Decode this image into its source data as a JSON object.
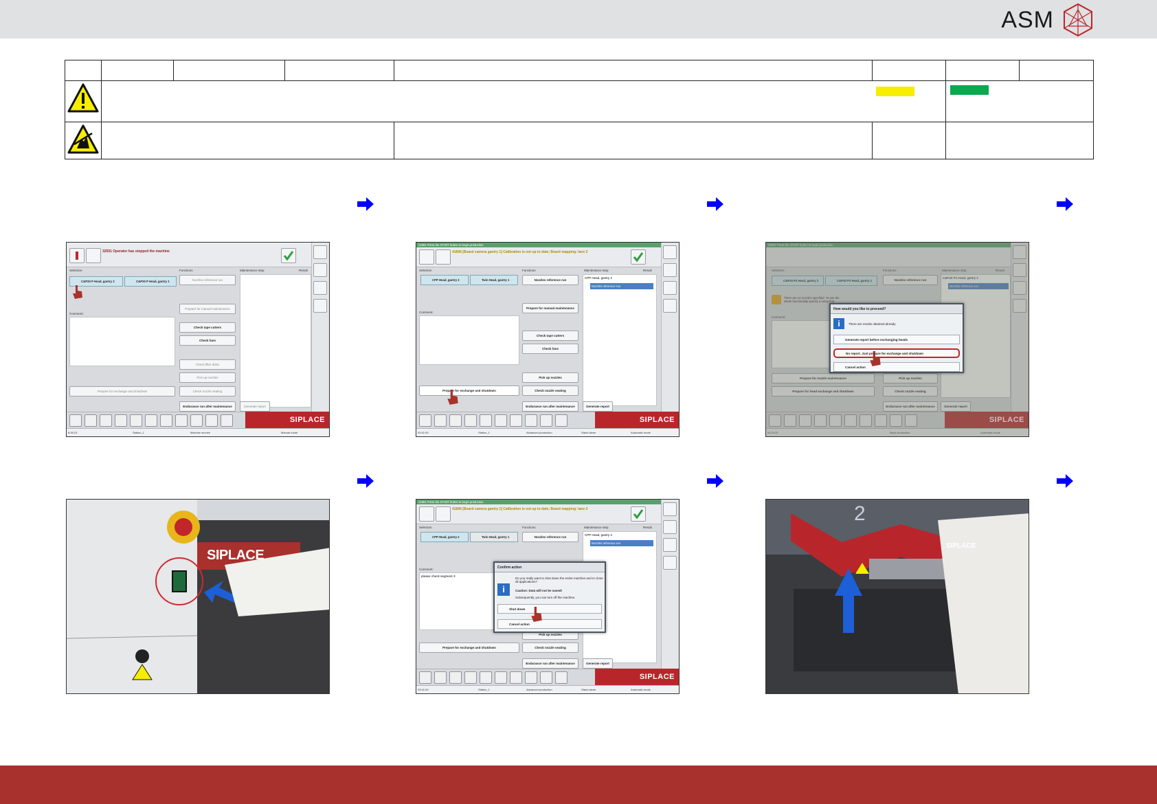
{
  "header": {
    "brand": "ASM"
  },
  "screens": {
    "s1": {
      "message": "32551 Operator has stopped the machine",
      "col_selection": "Selection",
      "col_functions": "Functions",
      "col_maint": "Maintenance step",
      "col_result": "Result",
      "head_a": "C&P20 P Head, gantry 2",
      "head_b": "C&P20 P Head, gantry 1",
      "btn_nozzles": "Nozzles reference run",
      "btn_prepare_manual": "Prepare for manual maintenance",
      "comment": "Comment:",
      "btn_tape": "Check tape cutters",
      "btn_fans": "Check fans",
      "btn_filter": "Check filter disks",
      "btn_pickup": "Pick up nozzles",
      "btn_check_nozzle": "Check nozzle seating",
      "btn_prepare_exchange": "Prepare for exchange and shutdown",
      "btn_endurance": "Endurance run after maintenance",
      "btn_report": "Generate report",
      "brand": "SIPLACE",
      "status_time": "8:35:23",
      "status_line": "Machine service",
      "status_station": "Station_1",
      "status_mode": "Manual mode"
    },
    "s2": {
      "topline": "21981 Press the START button to begin production",
      "message": "41806 [Board camera gantry 1] Calibration is not up to date; Board mapping: lane 2",
      "col_selection": "Selection",
      "col_functions": "Functions",
      "col_maint": "Maintenance step",
      "col_result": "Result",
      "head_a": "CPP Head, gantry 2",
      "head_b": "Twin Head, gantry 1",
      "maint_item": "CPP Head, gantry 2",
      "maint_sub": "Nozzles reference run",
      "btn_nozzles": "Nozzles reference run",
      "btn_prepare_manual": "Prepare for manual maintenance",
      "comment": "Comment:",
      "btn_tape": "Check tape cutters",
      "btn_fans": "Check fans",
      "btn_pickup": "Pick up nozzles",
      "btn_check_nozzle": "Check nozzle seating",
      "btn_prepare_exchange": "Prepare for exchange and shutdown",
      "btn_endurance": "Endurance run after maintenance",
      "btn_report": "Generate report",
      "brand": "SIPLACE",
      "status_time": "03:41:00",
      "status_station": "Station_1",
      "status_line": "Advanced production",
      "status_stand": "Stand alone",
      "status_mode": "Automatic mode"
    },
    "s3": {
      "topline": "20937 Press the START button to begin production",
      "dialog_title": "How would you like to proceed?",
      "dialog_info": "There are results obtained already",
      "opt_1": "Generate report before exchanging heads",
      "opt_2": "No report. Just prepare for exchange and shutdown",
      "opt_3": "Cancel action",
      "warn_text": "There are no nozzles specified. To use the whole functionality specify a setup first.",
      "comment": "Comment:",
      "col_selection": "Selection",
      "col_functions": "Functions",
      "col_maint": "Maintenance step",
      "col_result": "Result",
      "head_a": "C&P20 P2 Head, gantry 2",
      "head_b": "C&P20 P2 Head, gantry 1",
      "maint_item": "C&P20 P2 Head, gantry 2",
      "maint_sub": "Nozzles reference run",
      "btn_nozzles": "Nozzles reference run",
      "btn_prep_nozzle": "Prepare for nozzle maintenance",
      "btn_prep_head": "Prepare for head exchange and shutdown",
      "btn_pickup": "Pick up nozzles",
      "btn_check_nozzle": "Check nozzle seating",
      "btn_endurance": "Endurance run after maintenance",
      "btn_report": "Generate report",
      "brand": "SIPLACE",
      "status_time": "04:24:20",
      "status_line": "Basic production",
      "status_mode": "Automatic mode"
    },
    "s5": {
      "topline": "21981 Press the START button to begin production",
      "message": "41806 [Board camera gantry 1] Calibration is not up to date; Board mapping: lane 2",
      "dialog_title": "Confirm action",
      "dialog_q": "Do you really want to shut down the entire machine and to close all applications?",
      "dialog_caution": "Caution: Data will not be saved!",
      "dialog_sub": "Subsequently, you can turn off the machine.",
      "opt_shut": "Shut down",
      "opt_cancel": "Cancel action",
      "col_selection": "Selection",
      "col_functions": "Functions",
      "col_maint": "Maintenance step",
      "col_result": "Result",
      "head_a": "CPP Head, gantry 2",
      "head_b": "Twin Head, gantry 1",
      "maint_item": "CPP Head, gantry 2",
      "maint_sub": "Nozzles reference run",
      "btn_nozzles": "Nozzles reference run",
      "comment": "Comment:",
      "comment_text": "please check segment 3",
      "btn_pickup": "Pick up nozzles",
      "btn_prepare_exchange": "Prepare for exchange and shutdown",
      "btn_check_nozzle": "Check nozzle seating",
      "btn_endurance": "Endurance run after maintenance",
      "btn_report": "Generate report",
      "brand": "SIPLACE",
      "status_time": "03:41:00",
      "status_station": "Station_1",
      "status_line": "Advanced production",
      "status_stand": "Stand alone",
      "status_mode": "Automatic mode"
    },
    "photo_machine": {
      "label": "SIPLACE"
    },
    "photo_hood": {
      "label": "SIPLACE",
      "gantry_number": "2"
    }
  },
  "colors": {
    "accent_red": "#a8302d",
    "arrow_blue": "#0000ff",
    "status_green": "#0aa84f",
    "status_yellow": "#f6ed00"
  }
}
